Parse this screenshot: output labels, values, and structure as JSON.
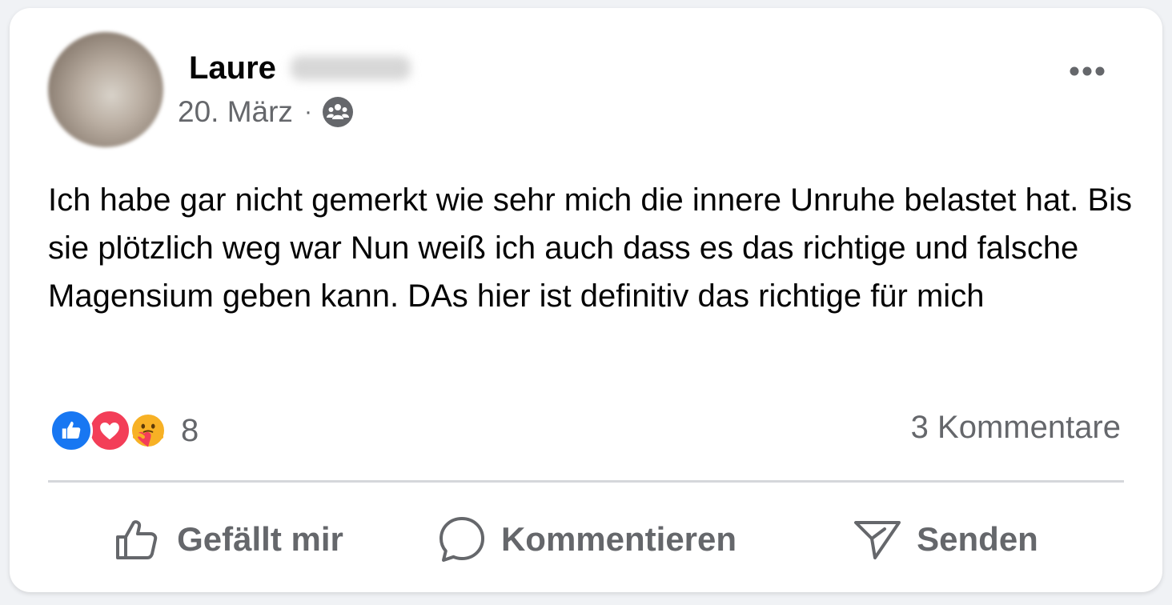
{
  "post": {
    "author_first_name": "Laure",
    "date": "20. März",
    "separator": "·",
    "audience_icon": "friends-icon",
    "text": "Ich habe gar nicht gemerkt wie sehr mich die innere Unruhe belastet hat. Bis sie plötzlich weg war  Nun weiß ich auch dass es das richtige und falsche Magensium geben kann. DAs hier ist definitiv das richtige für mich"
  },
  "reactions": {
    "types": [
      "like",
      "love",
      "care"
    ],
    "count": "8",
    "comments_label": "3 Kommentare"
  },
  "actions": {
    "like_label": "Gefällt mir",
    "comment_label": "Kommentieren",
    "send_label": "Senden"
  },
  "colors": {
    "like_blue": "#1877f2",
    "love_red": "#f33e58",
    "secondary_text": "#65676b"
  }
}
